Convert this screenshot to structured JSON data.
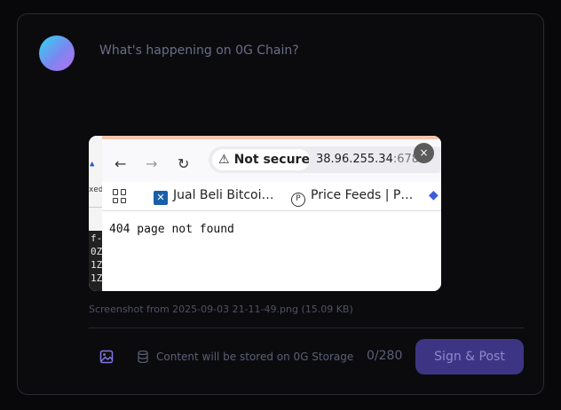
{
  "composer": {
    "placeholder": "What's happening on 0G Chain?"
  },
  "attachment": {
    "caption": "Screenshot from 2025-09-03 21-11-49.png (15.09 KB)",
    "close_symbol": "×",
    "screenshot": {
      "left_strip": {
        "mid_text": "xed",
        "terminal_lines": [
          "f-",
          "0Z",
          "1Z",
          "1Z"
        ]
      },
      "browser": {
        "nav": {
          "back": "←",
          "forward": "→",
          "reload": "↻"
        },
        "security_warning_icon": "⚠",
        "security_label": "Not secure",
        "url_host": "38.96.255.34",
        "url_port": ":6789",
        "bookmarks": [
          {
            "label": "Jual Beli Bitcoi…",
            "icon": "x-favicon"
          },
          {
            "label": "Price Feeds | P…",
            "icon": "p-favicon"
          }
        ],
        "page_text": "404 page not found"
      }
    }
  },
  "footer": {
    "storage_note": "Content will be stored on 0G Storage",
    "char_count": "0/280",
    "submit_label": "Sign & Post"
  },
  "colors": {
    "accent": "#3d3584",
    "icon_accent": "#7e75e0"
  }
}
